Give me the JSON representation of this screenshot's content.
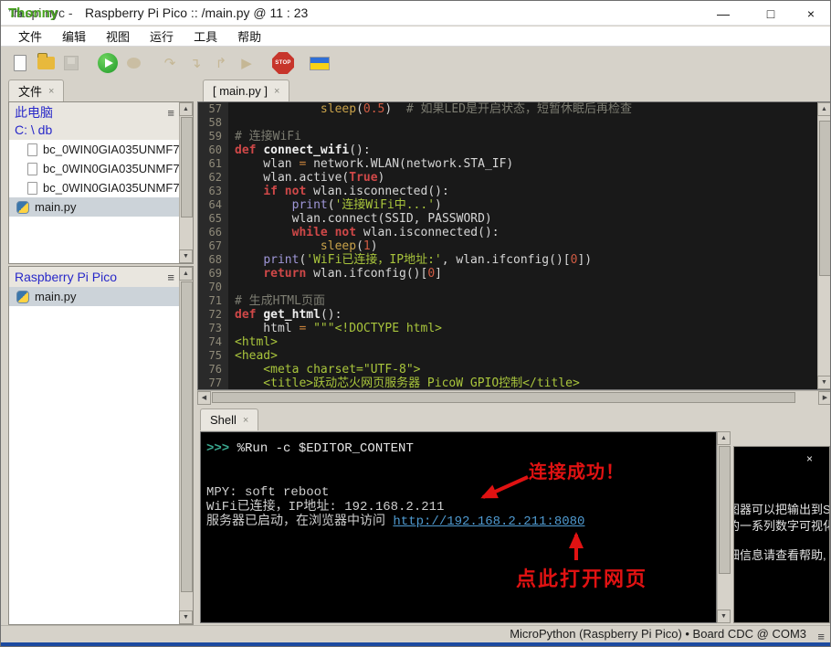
{
  "window": {
    "logo_text": "Th",
    "title_app": "Thonny",
    "title_watermark": "raspi.nyc -",
    "title_rest": "Raspberry Pi Pico :: /main.py  @  11 : 23",
    "controls": {
      "minimize": "—",
      "maximize": "□",
      "close": "×"
    }
  },
  "menu": {
    "items": [
      "文件",
      "编辑",
      "视图",
      "运行",
      "工具",
      "帮助"
    ]
  },
  "toolbar": {
    "stop_label": "STOP"
  },
  "files_panel": {
    "tab": "文件",
    "tab_close": "×",
    "computer_label": "此电脑",
    "path": "C: \\ db",
    "files": [
      {
        "name": "bc_0WIN0GIA035UNMF7_",
        "icon": "page",
        "selected": false
      },
      {
        "name": "bc_0WIN0GIA035UNMF7_",
        "icon": "page",
        "selected": false
      },
      {
        "name": "bc_0WIN0GIA035UNMF7_",
        "icon": "page",
        "selected": false
      },
      {
        "name": "main.py",
        "icon": "python",
        "selected": true
      }
    ],
    "pico_label": "Raspberry Pi Pico",
    "pico_files": [
      {
        "name": "main.py",
        "icon": "python",
        "selected": true
      }
    ]
  },
  "editor": {
    "tab": "[ main.py ]",
    "tab_close": "×",
    "lines": [
      {
        "n": "57",
        "t": [
          [
            "p",
            "            "
          ],
          [
            "bi2",
            "sleep"
          ],
          [
            "p",
            "("
          ],
          [
            "num",
            "0.5"
          ],
          [
            "p",
            ")  "
          ],
          [
            "com",
            "# 如果LED是开启状态，短暂休眠后再检查"
          ]
        ]
      },
      {
        "n": "58",
        "t": []
      },
      {
        "n": "59",
        "t": [
          [
            "com",
            "# 连接WiFi"
          ]
        ]
      },
      {
        "n": "60",
        "t": [
          [
            "kw",
            "def "
          ],
          [
            "fn",
            "connect_wifi"
          ],
          [
            "p",
            "():"
          ]
        ]
      },
      {
        "n": "61",
        "t": [
          [
            "p",
            "    wlan "
          ],
          [
            "op",
            "="
          ],
          [
            "p",
            " network.WLAN(network.STA_IF)"
          ]
        ]
      },
      {
        "n": "62",
        "t": [
          [
            "p",
            "    wlan.active("
          ],
          [
            "kw2",
            "True"
          ],
          [
            "p",
            ")"
          ]
        ]
      },
      {
        "n": "63",
        "t": [
          [
            "p",
            "    "
          ],
          [
            "kw",
            "if not "
          ],
          [
            "p",
            "wlan.isconnected():"
          ]
        ]
      },
      {
        "n": "64",
        "t": [
          [
            "p",
            "        "
          ],
          [
            "bi",
            "print"
          ],
          [
            "p",
            "("
          ],
          [
            "str",
            "'连接WiFi中...'"
          ],
          [
            "p",
            ")"
          ]
        ]
      },
      {
        "n": "65",
        "t": [
          [
            "p",
            "        wlan.connect(SSID, PASSWORD)"
          ]
        ]
      },
      {
        "n": "66",
        "t": [
          [
            "p",
            "        "
          ],
          [
            "kw",
            "while not "
          ],
          [
            "p",
            "wlan.isconnected():"
          ]
        ]
      },
      {
        "n": "67",
        "t": [
          [
            "p",
            "            "
          ],
          [
            "bi2",
            "sleep"
          ],
          [
            "p",
            "("
          ],
          [
            "num",
            "1"
          ],
          [
            "p",
            ")"
          ]
        ]
      },
      {
        "n": "68",
        "t": [
          [
            "p",
            "    "
          ],
          [
            "bi",
            "print"
          ],
          [
            "p",
            "("
          ],
          [
            "str",
            "'WiFi已连接，IP地址:'"
          ],
          [
            "p",
            ", wlan.ifconfig()["
          ],
          [
            "num",
            "0"
          ],
          [
            "p",
            "])"
          ]
        ]
      },
      {
        "n": "69",
        "t": [
          [
            "p",
            "    "
          ],
          [
            "kw",
            "return "
          ],
          [
            "p",
            "wlan.ifconfig()["
          ],
          [
            "num",
            "0"
          ],
          [
            "p",
            "]"
          ]
        ]
      },
      {
        "n": "70",
        "t": []
      },
      {
        "n": "71",
        "t": [
          [
            "com",
            "# 生成HTML页面"
          ]
        ]
      },
      {
        "n": "72",
        "t": [
          [
            "kw",
            "def "
          ],
          [
            "fn",
            "get_html"
          ],
          [
            "p",
            "():"
          ]
        ]
      },
      {
        "n": "73",
        "t": [
          [
            "p",
            "    html "
          ],
          [
            "op",
            "="
          ],
          [
            "p",
            " "
          ],
          [
            "str",
            "\"\"\"<!DOCTYPE html>"
          ]
        ]
      },
      {
        "n": "74",
        "t": [
          [
            "str",
            "<html>"
          ]
        ]
      },
      {
        "n": "75",
        "t": [
          [
            "str",
            "<head>"
          ]
        ]
      },
      {
        "n": "76",
        "t": [
          [
            "str",
            "    <meta charset=\"UTF-8\">"
          ]
        ]
      },
      {
        "n": "77",
        "t": [
          [
            "str",
            "    <title>跃动芯火网页服务器 PicoW GPIO控制</title>"
          ]
        ]
      }
    ]
  },
  "shell": {
    "tab": "Shell",
    "tab_close": "×",
    "lines": [
      [
        [
          "prompt",
          ">>> "
        ],
        [
          "cmd",
          "%Run -c $EDITOR_CONTENT"
        ]
      ],
      [],
      [],
      [
        [
          "out",
          "MPY: soft reboot"
        ]
      ],
      [
        [
          "out",
          "WiFi已连接，IP地址: 192.168.2.211"
        ]
      ],
      [
        [
          "out",
          "服务器已启动，在浏览器中访问 "
        ],
        [
          "link",
          "http://192.168.2.211:8080"
        ]
      ]
    ]
  },
  "annotations": {
    "success": "连接成功！",
    "open_page": "点此打开网页",
    "color": "#e01212"
  },
  "right_panel": {
    "close": "×",
    "lines": [
      "图器可以把输出到S",
      "的一系列数字可视化",
      "细信息请查看帮助,"
    ]
  },
  "statusbar": {
    "text": "MicroPython (Raspberry Pi Pico)  •  Board CDC @ COM3"
  }
}
